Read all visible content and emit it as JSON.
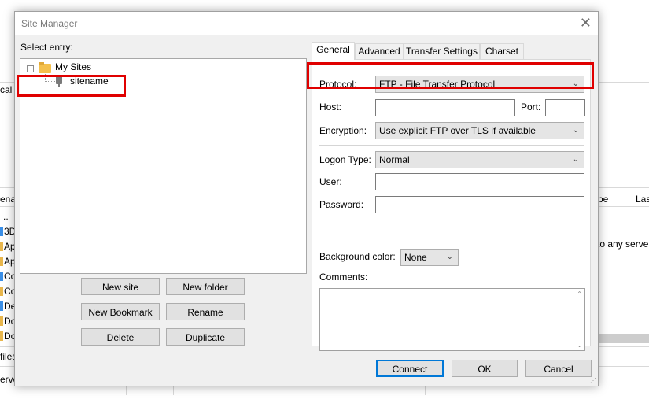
{
  "background_app": {
    "local_label": "cal",
    "col_name": "ena",
    "col_type": "pe",
    "col_last": "Las",
    "items": [
      "..",
      "3D",
      "Ap",
      "Ap",
      "Co",
      "Co",
      "De",
      "Do",
      "Do"
    ],
    "files_label": "files",
    "server_label": "erver",
    "connect_msg": "to any server"
  },
  "dialog": {
    "title": "Site Manager",
    "select_entry_label": "Select entry:",
    "tree": {
      "root": "My Sites",
      "child": "sitename"
    },
    "buttons": {
      "new_site": "New site",
      "new_folder": "New folder",
      "new_bookmark": "New Bookmark",
      "rename": "Rename",
      "delete": "Delete",
      "duplicate": "Duplicate",
      "connect": "Connect",
      "ok": "OK",
      "cancel": "Cancel"
    },
    "tabs": [
      "General",
      "Advanced",
      "Transfer Settings",
      "Charset"
    ],
    "general": {
      "protocol_label": "Protocol:",
      "protocol_value": "FTP - File Transfer Protocol",
      "host_label": "Host:",
      "host_value": "",
      "port_label": "Port:",
      "port_value": "",
      "encryption_label": "Encryption:",
      "encryption_value": "Use explicit FTP over TLS if available",
      "logon_type_label": "Logon Type:",
      "logon_type_value": "Normal",
      "user_label": "User:",
      "user_value": "",
      "password_label": "Password:",
      "password_value": "",
      "bg_color_label": "Background color:",
      "bg_color_value": "None",
      "comments_label": "Comments:",
      "comments_value": ""
    }
  },
  "colors": {
    "highlight": "#e00000",
    "focus": "#0078d7",
    "folder": "#e8b64c"
  }
}
